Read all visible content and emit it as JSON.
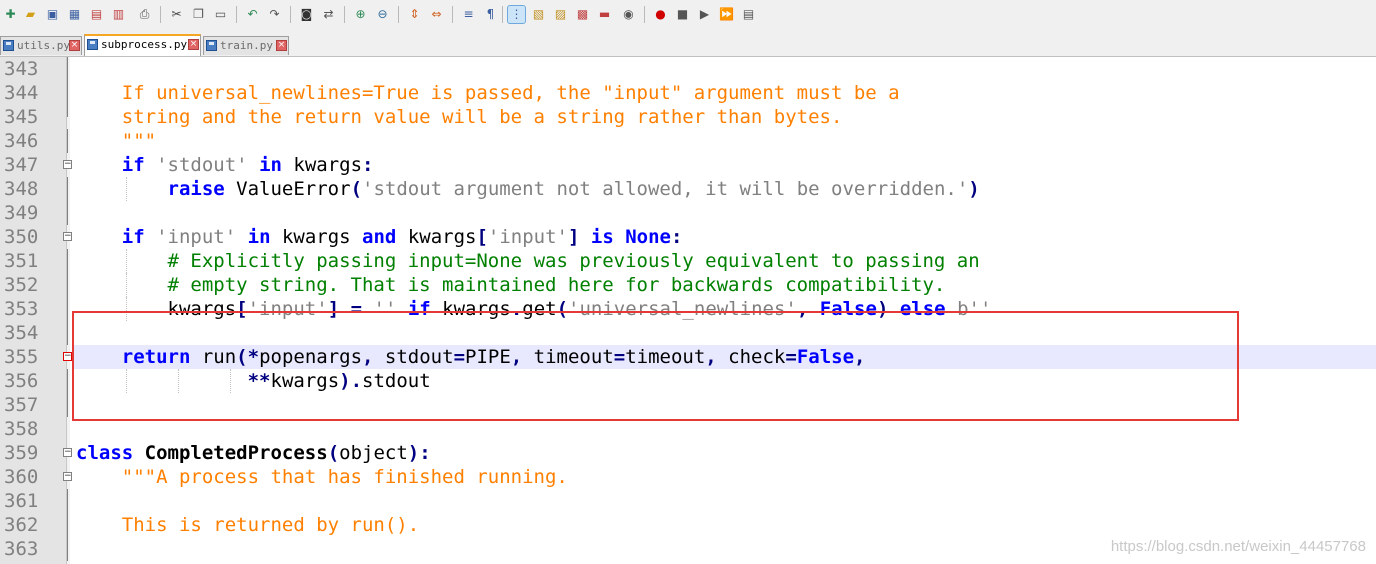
{
  "toolbar": {
    "icons": [
      "new-file-icon",
      "open-file-icon",
      "save-icon",
      "save-all-icon",
      "close-icon",
      "close-all-icon",
      "print-icon",
      "cut-icon",
      "copy-icon",
      "paste-icon",
      "undo-icon",
      "redo-icon",
      "find-icon",
      "replace-icon",
      "zoom-in-icon",
      "zoom-out-icon",
      "sync-vertical-icon",
      "sync-horizontal-icon",
      "word-wrap-icon",
      "show-all-chars-icon",
      "indent-guide-icon",
      "document-map-icon",
      "function-list-icon",
      "folder-workspace-icon",
      "monitoring-icon",
      "start-recording-icon",
      "stop-recording-icon",
      "playback-icon",
      "run-macro-multiple-icon",
      "save-macro-icon"
    ]
  },
  "tabs": [
    {
      "label": "utils.py",
      "active": false
    },
    {
      "label": "subprocess.py",
      "active": true
    },
    {
      "label": "train.py",
      "active": false
    }
  ],
  "editor": {
    "lines": [
      {
        "num": "343",
        "code": ""
      },
      {
        "num": "344",
        "code": "    If universal_newlines=True is passed, the \"input\" argument must be a"
      },
      {
        "num": "345",
        "code": "    string and the return value will be a string rather than bytes."
      },
      {
        "num": "346",
        "code": "    \"\"\""
      },
      {
        "num": "347",
        "code": "    if 'stdout' in kwargs:"
      },
      {
        "num": "348",
        "code": "        raise ValueError('stdout argument not allowed, it will be overridden.')"
      },
      {
        "num": "349",
        "code": ""
      },
      {
        "num": "350",
        "code": "    if 'input' in kwargs and kwargs['input'] is None:"
      },
      {
        "num": "351",
        "code": "        # Explicitly passing input=None was previously equivalent to passing an"
      },
      {
        "num": "352",
        "code": "        # empty string. That is maintained here for backwards compatibility."
      },
      {
        "num": "353",
        "code": "        kwargs['input'] = '' if kwargs.get('universal_newlines', False) else b''"
      },
      {
        "num": "354",
        "code": ""
      },
      {
        "num": "355",
        "code": "    return run(*popenargs, stdout=PIPE, timeout=timeout, check=False,"
      },
      {
        "num": "356",
        "code": "               **kwargs).stdout"
      },
      {
        "num": "357",
        "code": ""
      },
      {
        "num": "358",
        "code": ""
      },
      {
        "num": "359",
        "code": "class CompletedProcess(object):"
      },
      {
        "num": "360",
        "code": "    \"\"\"A process that has finished running."
      },
      {
        "num": "361",
        "code": ""
      },
      {
        "num": "362",
        "code": "    This is returned by run()."
      },
      {
        "num": "363",
        "code": ""
      }
    ]
  },
  "watermark": "https://blog.csdn.net/weixin_44457768",
  "colors": {
    "keyword": "#0000ff",
    "string": "#808080",
    "docstring": "#ff8000",
    "comment": "#008000",
    "highlight": "#e53935",
    "current_line": "#e8e8ff"
  }
}
